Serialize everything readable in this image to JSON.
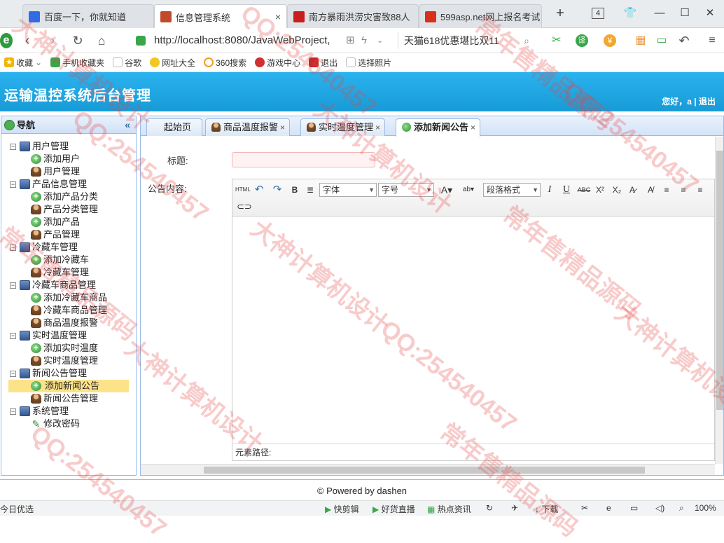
{
  "browser": {
    "tabs": [
      {
        "label": "百度一下，你就知道",
        "active": false
      },
      {
        "label": "信息管理系统",
        "active": true
      },
      {
        "label": "南方暴雨洪涝灾害致88人",
        "active": false
      },
      {
        "label": "599asp.net网上报名考试",
        "active": false
      }
    ],
    "tab_count": "4",
    "url": "http://localhost:8080/JavaWebProject,",
    "search_text": "天猫618优惠堪比双11",
    "bookmarks": [
      "收藏",
      "手机收藏夹",
      "谷歌",
      "网址大全",
      "360搜索",
      "游戏中心",
      "退出",
      "选择照片"
    ]
  },
  "app": {
    "title": "运输温控系统后台管理",
    "userbar": "您好，a | 退出"
  },
  "nav": {
    "title": "导航",
    "collapse_glyph": "«",
    "groups": [
      {
        "label": "用户管理",
        "items": [
          {
            "label": "添加用户",
            "icon": "add"
          },
          {
            "label": "用户管理",
            "icon": "user"
          }
        ]
      },
      {
        "label": "产品信息管理",
        "items": [
          {
            "label": "添加产品分类",
            "icon": "add"
          },
          {
            "label": "产品分类管理",
            "icon": "user"
          },
          {
            "label": "添加产品",
            "icon": "add"
          },
          {
            "label": "产品管理",
            "icon": "user"
          }
        ]
      },
      {
        "label": "冷藏车管理",
        "items": [
          {
            "label": "添加冷藏车",
            "icon": "add"
          },
          {
            "label": "冷藏车管理",
            "icon": "user"
          }
        ]
      },
      {
        "label": "冷藏车商品管理",
        "items": [
          {
            "label": "添加冷藏车商品",
            "icon": "add"
          },
          {
            "label": "冷藏车商品管理",
            "icon": "user"
          },
          {
            "label": "商品温度报警",
            "icon": "user"
          }
        ]
      },
      {
        "label": "实时温度管理",
        "items": [
          {
            "label": "添加实时温度",
            "icon": "add"
          },
          {
            "label": "实时温度管理",
            "icon": "user"
          }
        ]
      },
      {
        "label": "新闻公告管理",
        "items": [
          {
            "label": "添加新闻公告",
            "icon": "add",
            "selected": true
          },
          {
            "label": "新闻公告管理",
            "icon": "user"
          }
        ]
      },
      {
        "label": "系统管理",
        "items": [
          {
            "label": "修改密码",
            "icon": "pen"
          }
        ]
      }
    ]
  },
  "main_tabs": [
    {
      "label": "起始页",
      "closable": false
    },
    {
      "label": "商品温度报警",
      "closable": true
    },
    {
      "label": "实时温度管理",
      "closable": true
    },
    {
      "label": "添加新闻公告",
      "closable": true,
      "active": true
    }
  ],
  "form": {
    "title_label": "标题:",
    "title_value": "",
    "content_label": "公告内容:",
    "toolbar": {
      "html": "HTML",
      "font_family": "字体",
      "font_size": "字号",
      "paragraph": "段落格式",
      "bold": "B",
      "italic": "I",
      "underline": "U",
      "strike": "ABC",
      "sup": "X²",
      "sub": "X₂"
    },
    "element_path": "元素路径:"
  },
  "footer": "© Powered by dashen",
  "statusbar": {
    "left": "今日优选",
    "items": [
      "快剪辑",
      "好货直播",
      "热点资讯",
      "下载"
    ],
    "zoom": "100%"
  },
  "watermark": [
    "大神计算机设计",
    "QQ:254540457",
    "常年售精品源码"
  ]
}
